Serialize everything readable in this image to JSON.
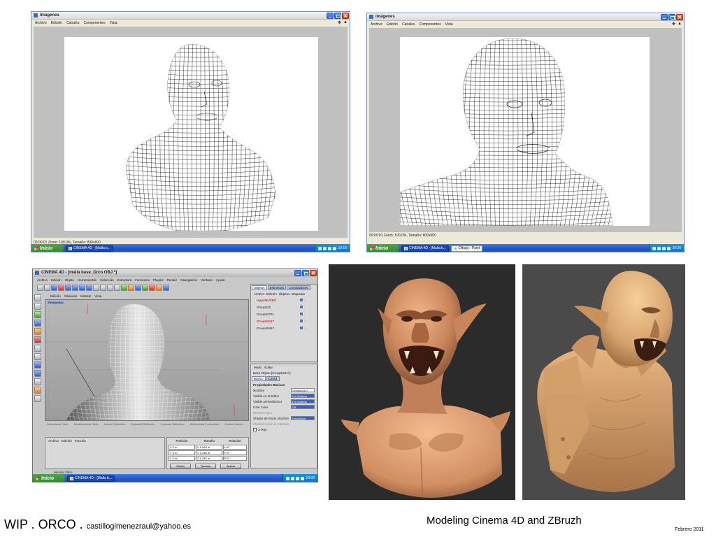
{
  "window1": {
    "title": "Imágenes",
    "menu": [
      "Archivo",
      "Edición",
      "Canales",
      "Componentes",
      "Vista"
    ],
    "status": "00:00:01  Zoom: 100.0%, Tamaño: 800x600",
    "taskbar": {
      "start": "Inicio",
      "items": [
        "CINEMA 4D - [Malla b..."
      ],
      "clock": "10:16"
    }
  },
  "window2": {
    "title": "Imágenes",
    "menu": [
      "Archivo",
      "Edición",
      "Canales",
      "Componentes",
      "Vista"
    ],
    "status": "00:00:01  Zoom: 100.0%, Tamaño: 800x600",
    "taskbar": {
      "start": "Inicio",
      "items": [
        "CINEMA 4D - [Malla b...",
        "Dibujo - Paint"
      ],
      "clock": "10:20"
    }
  },
  "c4d": {
    "title": "CINEMA 4D - [malla base_Orco OBJ *]",
    "menu": [
      "Archivo",
      "Edición",
      "Objeto",
      "Herramientas",
      "Selección",
      "Estructura",
      "Funciones",
      "Plugins",
      "Render",
      "Navegación",
      "Ventana",
      "Ayuda"
    ],
    "viewport_menu": [
      "Edición",
      "Cámaras",
      "Mostrar",
      "Vista"
    ],
    "viewport_label": "Perspectiva",
    "timeline": [
      "Seleccionar Todo",
      "Deseleccionar Todo",
      "Invertir Selección",
      "Expandir Selección",
      "Contraer Selección",
      "Seleccionar Conectado",
      "Ocultar Selecc..."
    ],
    "object_tabs": [
      "Objetos",
      "Estructura",
      "Localizadores"
    ],
    "object_menu": [
      "Archivo",
      "Edición",
      "Objetos",
      "Etiquetas"
    ],
    "objects": [
      {
        "name": "HyperNURBS",
        "color": "red"
      },
      {
        "name": "Group022",
        "color": "normal"
      },
      {
        "name": "Group53791",
        "color": "normal"
      },
      {
        "name": "Group63417",
        "color": "red"
      },
      {
        "name": "Group49467",
        "color": "normal"
      }
    ],
    "attributes": {
      "menu": [
        "Modo",
        "Editar"
      ],
      "header": "Base Objeto [Group63417]",
      "tabs": [
        "Básico",
        "Coord."
      ],
      "section": "Propiedades Básicas",
      "rows": [
        {
          "label": "Nombre",
          "value": "Group63417",
          "style": "white"
        },
        {
          "label": "Visible en el Editor",
          "value": "Por Defecto",
          "style": "blue"
        },
        {
          "label": "Visible al Renderizar",
          "value": "Por Defecto",
          "style": "blue"
        },
        {
          "label": "Usar Color",
          "value": "Off",
          "style": "blue"
        },
        {
          "label": "Mostrar Color",
          "value": "",
          "style": "grey"
        },
        {
          "label": "Shader de Modo Alambre",
          "value": "Desactivar",
          "style": "blue"
        },
        {
          "label": "Shaded Color de Alambre",
          "value": "",
          "style": "grey"
        },
        {
          "label": "X-Ray",
          "value": "",
          "style": "check"
        }
      ]
    },
    "material_menu": [
      "Archivo",
      "Edición",
      "Función"
    ],
    "coords": {
      "headers": [
        "Posición",
        "Tamaño",
        "Rotación"
      ],
      "position": [
        "0 m",
        "0 m",
        "0 m"
      ],
      "size": [
        "0.643 m",
        "1.345 m",
        "1.235 m"
      ],
      "rotation": [
        "0 °",
        "0 °",
        "0 °"
      ],
      "axes_pos": [
        "X",
        "Y",
        "Z"
      ],
      "axes_rot": [
        "H",
        "P",
        "B"
      ],
      "buttons": [
        "Objeto",
        "Tamaño",
        "Aplicar"
      ]
    },
    "hint": "Mostrar Filtro",
    "taskbar": {
      "start": "Inicio",
      "items": [
        "CINEMA 4D - [Malla b..."
      ],
      "clock": "10:09"
    }
  },
  "captions": {
    "left_main": "WIP . ORCO . ",
    "left_email": "castillogimenezraul@yahoo.es",
    "middle": "Modeling Cinema 4D and ZBruzh",
    "right": "Febrero 2011"
  }
}
